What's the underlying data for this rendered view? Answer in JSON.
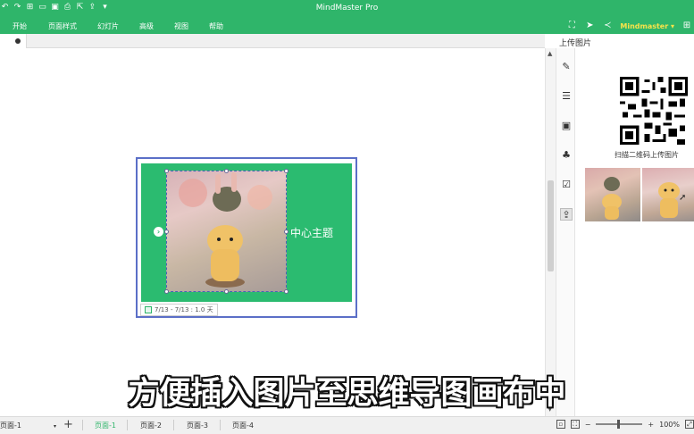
{
  "app": {
    "title": "MindMaster Pro",
    "brand": "Mindmaster"
  },
  "quick_access": [
    "back-icon",
    "redo-icon",
    "new-icon",
    "open-icon",
    "save-icon",
    "print-icon",
    "export-icon",
    "share-icon",
    "more-icon"
  ],
  "menu": [
    "开始",
    "页面样式",
    "幻灯片",
    "高级",
    "视图",
    "帮助"
  ],
  "right_tools": [
    "fullscreen-icon",
    "send-icon",
    "share-icon"
  ],
  "canvas": {
    "topic_text": "中心主题",
    "task_info": "7/13 - 7/13 : 1.0 天"
  },
  "rail_icons": [
    "paint-icon",
    "list-icon",
    "image-icon",
    "clipart-icon",
    "task-icon",
    "upload-icon"
  ],
  "panel": {
    "title": "上传图片",
    "scan_text": "扫描二维码上传图片"
  },
  "caption": "方便插入图片至思维导图画布中",
  "bottom": {
    "current_page": "页面-1",
    "page_tabs": [
      "页面-1",
      "页面-2",
      "页面-3",
      "页面-4"
    ],
    "active_tab_index": 0,
    "zoom": "100%"
  },
  "colors": {
    "accent": "#2fb56a",
    "topic": "#2bbb70",
    "selection": "#5b6fc7",
    "brand": "#f7e34a"
  }
}
